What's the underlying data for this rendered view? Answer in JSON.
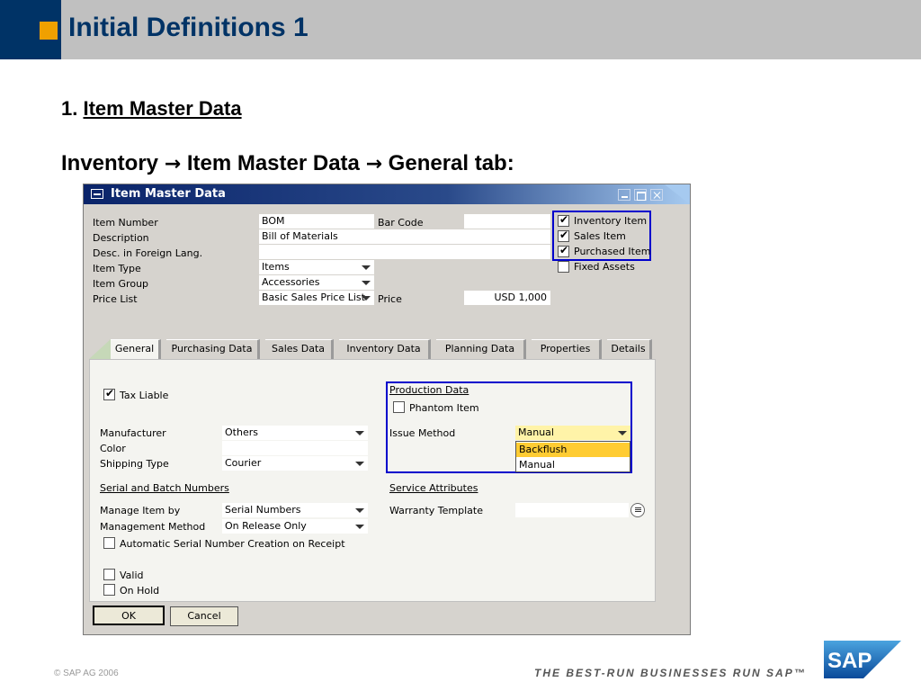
{
  "slide": {
    "title": "Initial Definitions 1",
    "section_number": "1.",
    "section_title": "Item Master Data",
    "path_part1": "Inventory",
    "path_arrow": "→",
    "path_part2": "Item Master Data",
    "path_part3": "General tab:",
    "copyright": "© SAP AG 2006",
    "tagline": "THE BEST-RUN BUSINESSES RUN SAP™",
    "logo_text": "SAP"
  },
  "window": {
    "title": "Item Master Data"
  },
  "header_fields": {
    "item_number_label": "Item Number",
    "item_number_value": "BOM",
    "bar_code_label": "Bar Code",
    "bar_code_value": "",
    "description_label": "Description",
    "description_value": "Bill of Materials",
    "foreign_desc_label": "Desc. in Foreign Lang.",
    "foreign_desc_value": "",
    "item_type_label": "Item Type",
    "item_type_value": "Items",
    "item_group_label": "Item Group",
    "item_group_value": "Accessories",
    "price_list_label": "Price List",
    "price_list_value": "Basic Sales Price List",
    "price_label": "Price",
    "price_value": "USD 1,000"
  },
  "item_flags": [
    {
      "label": "Inventory Item",
      "checked": true
    },
    {
      "label": "Sales Item",
      "checked": true
    },
    {
      "label": "Purchased Item",
      "checked": true
    },
    {
      "label": "Fixed Assets",
      "checked": false
    }
  ],
  "tabs": [
    {
      "label": "General",
      "active": true
    },
    {
      "label": "Purchasing Data",
      "active": false
    },
    {
      "label": "Sales Data",
      "active": false
    },
    {
      "label": "Inventory Data",
      "active": false
    },
    {
      "label": "Planning Data",
      "active": false
    },
    {
      "label": "Properties",
      "active": false
    },
    {
      "label": "Details",
      "active": false
    }
  ],
  "general": {
    "tax_liable_label": "Tax Liable",
    "tax_liable_checked": true,
    "manufacturer_label": "Manufacturer",
    "manufacturer_value": "Others",
    "color_label": "Color",
    "color_value": "",
    "shipping_type_label": "Shipping Type",
    "shipping_type_value": "Courier",
    "serial_batch_heading": "Serial and Batch Numbers",
    "manage_item_by_label": "Manage Item by",
    "manage_item_by_value": "Serial Numbers",
    "management_method_label": "Management Method",
    "management_method_value": "On Release Only",
    "auto_serial_label": "Automatic Serial Number Creation on Receipt",
    "valid_label": "Valid",
    "on_hold_label": "On Hold",
    "production_heading": "Production Data",
    "phantom_item_label": "Phantom Item",
    "issue_method_label": "Issue Method",
    "issue_method_value": "Manual",
    "issue_method_options": [
      "Backflush",
      "Manual"
    ],
    "service_heading": "Service Attributes",
    "warranty_template_label": "Warranty Template",
    "warranty_template_value": ""
  },
  "buttons": {
    "ok": "OK",
    "cancel": "Cancel"
  },
  "colors": {
    "highlight_box": "#0000cc",
    "dropdown_selected": "#ffcc33",
    "title_blue": "#003366",
    "accent_orange": "#f0a000"
  }
}
